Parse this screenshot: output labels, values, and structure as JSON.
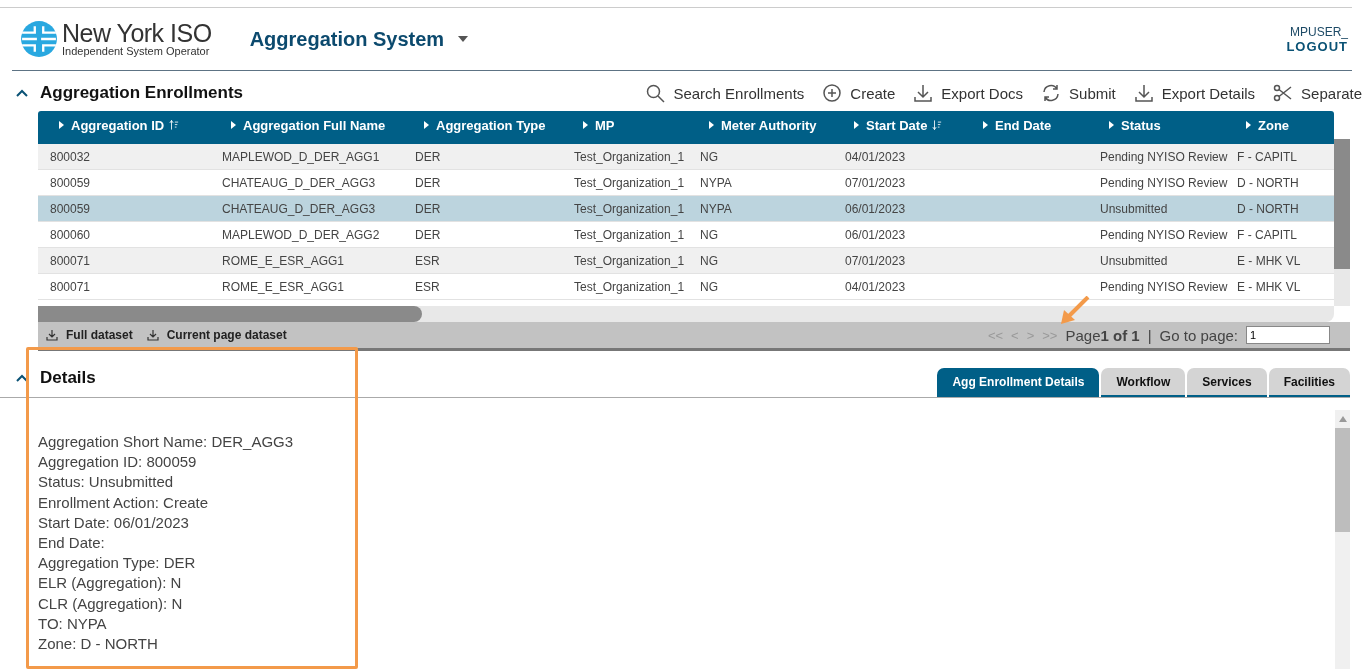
{
  "header": {
    "logo_title": "New York ISO",
    "logo_subtitle": "Independent System Operator",
    "app_title": "Aggregation System",
    "user": "MPUSER_",
    "logout": "LOGOUT"
  },
  "enrollments": {
    "title": "Aggregation Enrollments",
    "expanded": true,
    "actions": [
      {
        "kind": "search",
        "label": "Search Enrollments"
      },
      {
        "kind": "create",
        "label": "Create"
      },
      {
        "kind": "download",
        "label": "Export Docs"
      },
      {
        "kind": "refresh",
        "label": "Submit"
      },
      {
        "kind": "download",
        "label": "Export Details"
      },
      {
        "kind": "scissors",
        "label": "Separate"
      }
    ],
    "columns": [
      {
        "label": "Aggregation ID",
        "sort_descending": false
      },
      {
        "label": "Aggregation Full Name"
      },
      {
        "label": "Aggregation Type"
      },
      {
        "label": "MP"
      },
      {
        "label": "Meter Authority"
      },
      {
        "label": "Start Date",
        "sort_descending": true
      },
      {
        "label": "End Date"
      },
      {
        "label": "Status"
      },
      {
        "label": "Zone"
      }
    ],
    "rows": [
      {
        "selected": false,
        "cells": [
          "800032",
          "MAPLEWOD_D_DER_AGG1",
          "DER",
          "Test_Organization_1",
          "NG",
          "04/01/2023",
          "",
          "Pending NYISO Review",
          "F - CAPITL"
        ]
      },
      {
        "selected": false,
        "cells": [
          "800059",
          "CHATEAUG_D_DER_AGG3",
          "DER",
          "Test_Organization_1",
          "NYPA",
          "07/01/2023",
          "",
          "Pending NYISO Review",
          "D - NORTH"
        ]
      },
      {
        "selected": true,
        "cells": [
          "800059",
          "CHATEAUG_D_DER_AGG3",
          "DER",
          "Test_Organization_1",
          "NYPA",
          "06/01/2023",
          "",
          "Unsubmitted",
          "D - NORTH"
        ]
      },
      {
        "selected": false,
        "cells": [
          "800060",
          "MAPLEWOD_D_DER_AGG2",
          "DER",
          "Test_Organization_1",
          "NG",
          "06/01/2023",
          "",
          "Pending NYISO Review",
          "F - CAPITL"
        ]
      },
      {
        "selected": false,
        "cells": [
          "800071",
          "ROME_E_ESR_AGG1",
          "ESR",
          "Test_Organization_1",
          "NG",
          "07/01/2023",
          "",
          "Unsubmitted",
          "E - MHK VL"
        ]
      },
      {
        "selected": false,
        "cells": [
          "800071",
          "ROME_E_ESR_AGG1",
          "ESR",
          "Test_Organization_1",
          "NG",
          "04/01/2023",
          "",
          "Pending NYISO Review",
          "E - MHK VL"
        ]
      }
    ],
    "downloads": [
      "Full dataset",
      "Current page dataset"
    ],
    "pager": {
      "first": "<<",
      "prev": "<",
      "next": ">",
      "last": ">>",
      "page_label": "Page",
      "page_value": "1 of 1",
      "separator": "|",
      "goto_label": "Go to page:",
      "goto_value": "1"
    }
  },
  "details": {
    "title": "Details",
    "expanded": true,
    "tabs": [
      {
        "label": "Agg Enrollment Details",
        "selected": true
      },
      {
        "label": "Workflow",
        "selected": false
      },
      {
        "label": "Services",
        "selected": false
      },
      {
        "label": "Facilities",
        "selected": false
      }
    ],
    "lines": [
      "Aggregation Short Name: DER_AGG3",
      "Aggregation ID: 800059",
      "Status: Unsubmitted",
      "Enrollment Action: Create",
      "Start Date: 06/01/2023",
      "End Date:",
      "Aggregation Type: DER",
      "ELR (Aggregation): N",
      "CLR (Aggregation): N",
      "TO: NYPA",
      "Zone: D - NORTH"
    ]
  }
}
